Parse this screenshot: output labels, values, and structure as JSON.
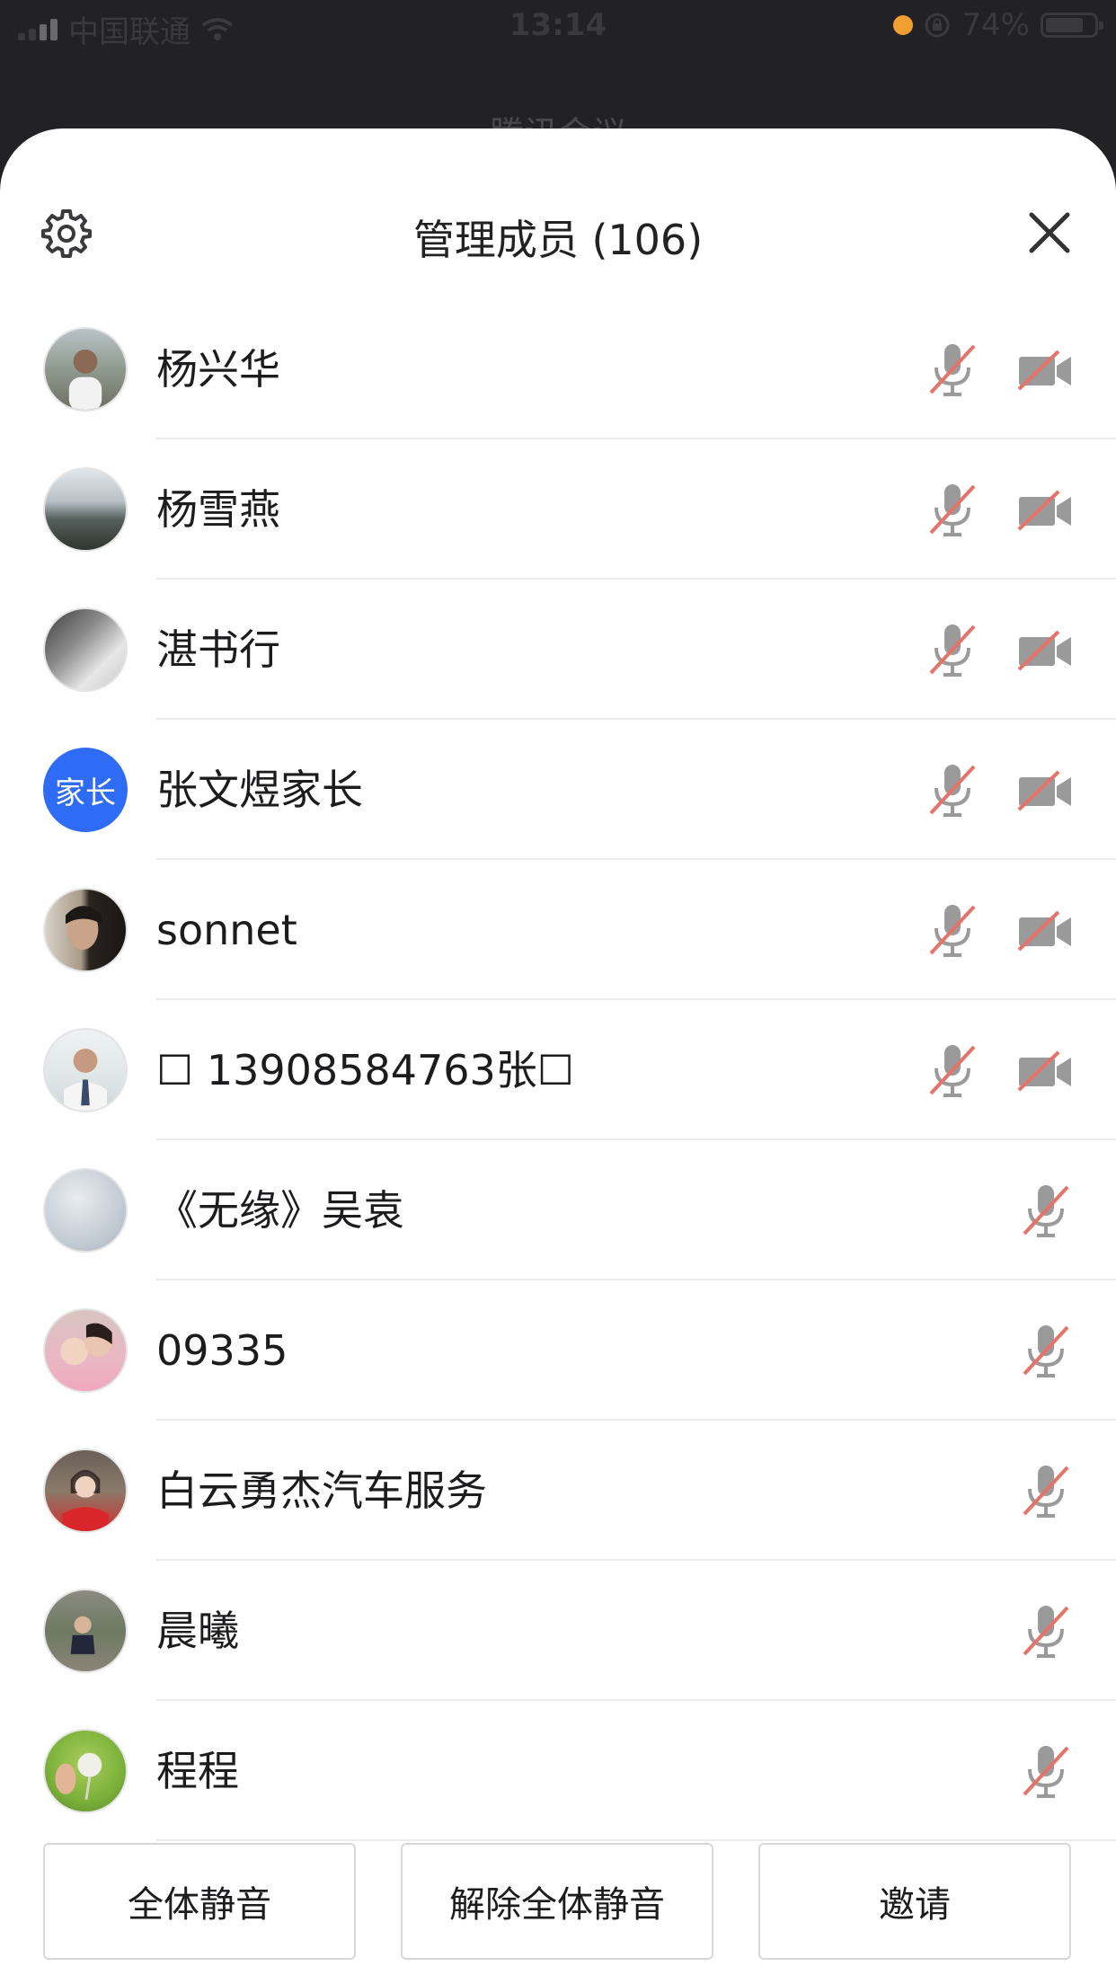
{
  "status_bar": {
    "carrier": "中国联通",
    "time": "13:14",
    "battery": "74%"
  },
  "meeting_title": "腾讯会议",
  "header": {
    "title": "管理成员 (106)"
  },
  "members": [
    {
      "name": "杨兴华",
      "camera_shown": true
    },
    {
      "name": "杨雪燕",
      "camera_shown": true
    },
    {
      "name": "湛书行",
      "camera_shown": true
    },
    {
      "name": "张文煜家长",
      "camera_shown": true,
      "avatar_text": "家长"
    },
    {
      "name": "sonnet",
      "camera_shown": true
    },
    {
      "name": "☐ 13908584763张☐",
      "camera_shown": true
    },
    {
      "name": "《无缘》吴袁",
      "camera_shown": false
    },
    {
      "name": "09335",
      "camera_shown": false
    },
    {
      "name": "白云勇杰汽车服务",
      "camera_shown": false
    },
    {
      "name": "晨曦",
      "camera_shown": false
    },
    {
      "name": "程程",
      "camera_shown": false
    }
  ],
  "footer": {
    "mute_all": "全体静音",
    "unmute_all": "解除全体静音",
    "invite": "邀请"
  },
  "colors": {
    "accent_blue": "#2f6cf5",
    "muted_slash": "#e5736a",
    "icon_grey": "#9a9a9a"
  }
}
